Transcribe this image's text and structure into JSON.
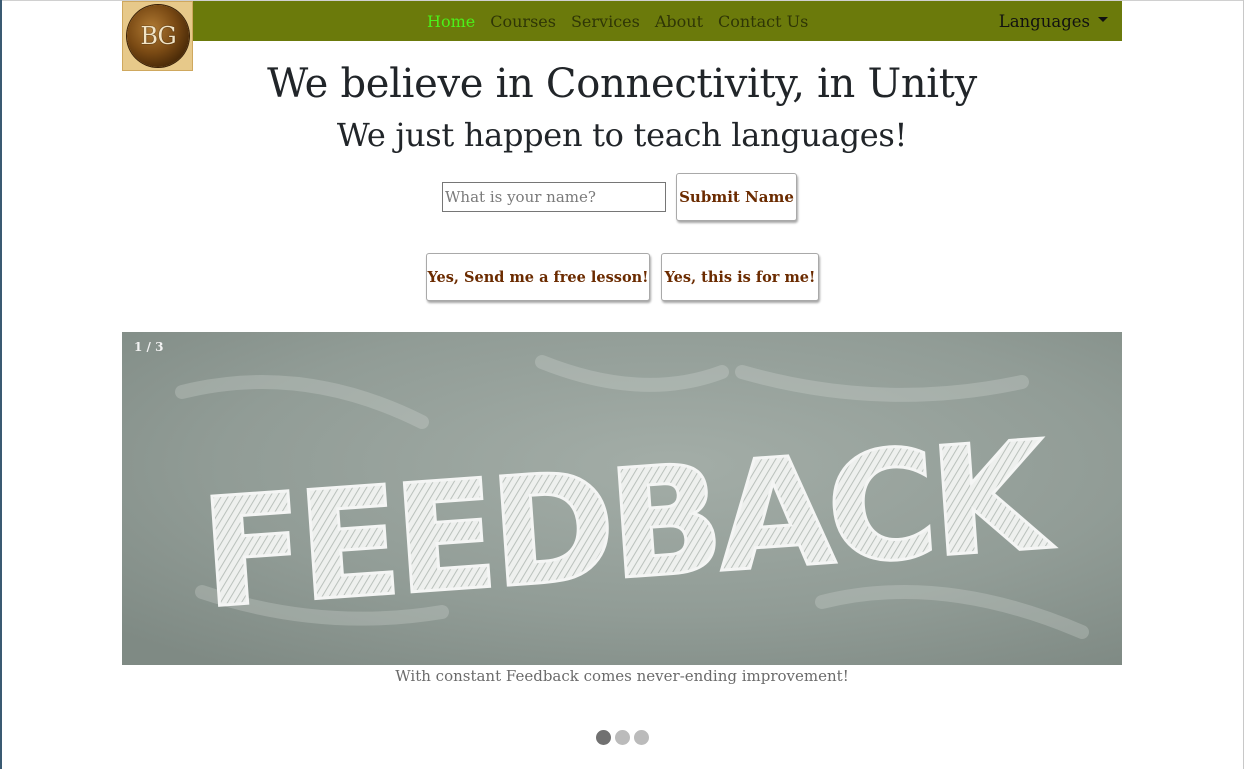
{
  "brand": {
    "logo_text": "BG"
  },
  "nav": {
    "links": [
      {
        "label": "Home",
        "active": true
      },
      {
        "label": "Courses",
        "active": false
      },
      {
        "label": "Services",
        "active": false
      },
      {
        "label": "About",
        "active": false
      },
      {
        "label": "Contact Us",
        "active": false
      }
    ],
    "dropdown_label": "Languages"
  },
  "hero": {
    "title": "We believe in Connectivity, in Unity",
    "subtitle": "We just happen to teach languages!"
  },
  "form": {
    "name_placeholder": "What is your name?",
    "name_value": "",
    "submit_label": "Submit Name"
  },
  "cta": {
    "free_lesson_label": "Yes, Send me a free lesson!",
    "for_me_label": "Yes, this is for me!"
  },
  "slideshow": {
    "counter": "1 / 3",
    "image_word": "FEEDBACK",
    "caption": "With constant Feedback comes never-ending improvement!",
    "dots": [
      {
        "active": true
      },
      {
        "active": false
      },
      {
        "active": false
      }
    ]
  },
  "colors": {
    "navbar": "#6b7a0b",
    "nav_active": "#4cf01a",
    "nav_link": "#2f3606",
    "button_text": "#6b2b00",
    "chalkboard": "#95a09a"
  }
}
